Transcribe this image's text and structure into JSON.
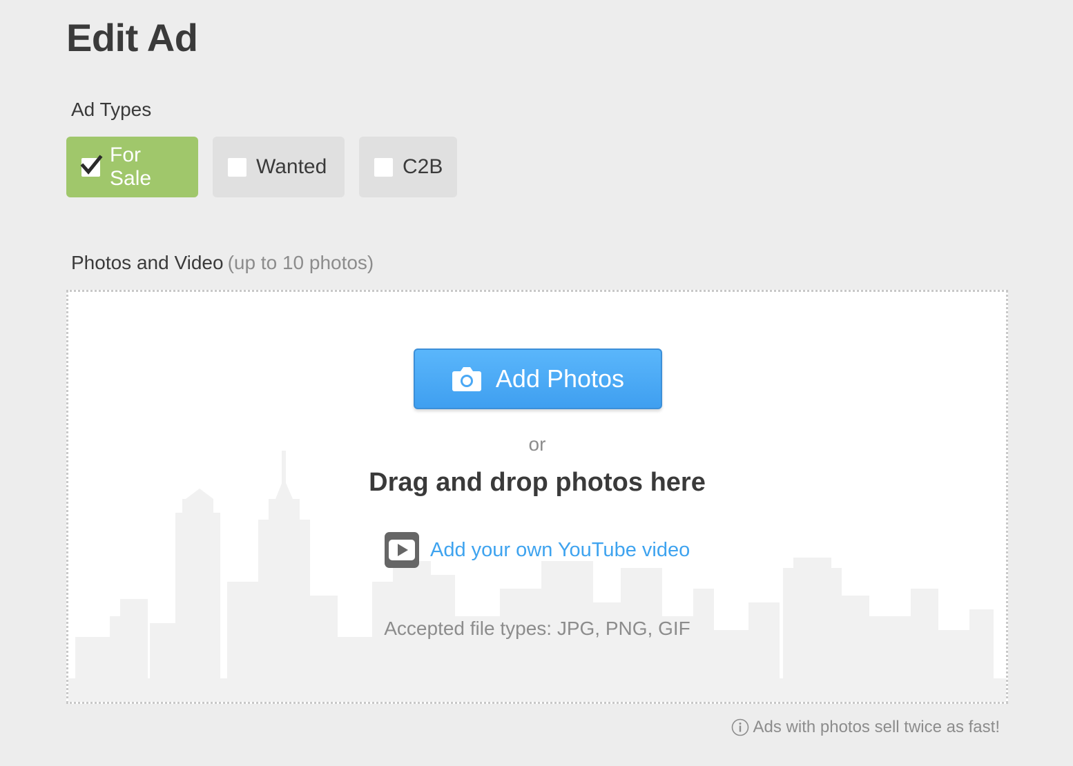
{
  "page": {
    "title": "Edit Ad"
  },
  "ad_types": {
    "label": "Ad Types",
    "options": [
      {
        "label": "For Sale",
        "checked": true
      },
      {
        "label": "Wanted",
        "checked": false
      },
      {
        "label": "C2B",
        "checked": false
      }
    ]
  },
  "photos": {
    "label": "Photos and Video",
    "hint": "(up to 10 photos)",
    "add_button_label": "Add Photos",
    "or_text": "or",
    "drag_text": "Drag and drop photos here",
    "youtube_link": "Add your own YouTube video",
    "accepted_types": "Accepted file types: JPG, PNG, GIF",
    "tip": "Ads with photos sell twice as fast!"
  },
  "colors": {
    "selected_green": "#a0c76b",
    "button_blue": "#4aa8f5",
    "link_blue": "#3ea3ef",
    "background": "#ededed"
  },
  "icons": {
    "check": "check-icon",
    "camera": "camera-icon",
    "youtube": "youtube-play-icon",
    "info": "info-icon"
  }
}
